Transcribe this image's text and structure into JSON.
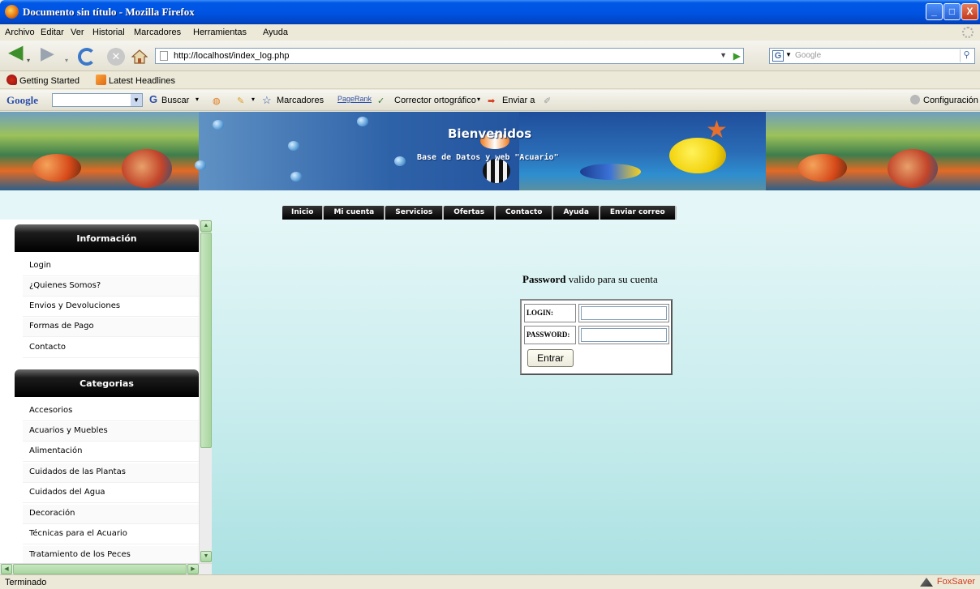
{
  "window": {
    "title": "Documento sin título - Mozilla Firefox",
    "min": "_",
    "max": "□",
    "close": "X"
  },
  "menubar": [
    "Archivo",
    "Editar",
    "Ver",
    "Historial",
    "Marcadores",
    "Herramientas",
    "Ayuda"
  ],
  "nav": {
    "url": "http://localhost/index_log.php",
    "search_placeholder": "Google",
    "search_engine_letter": "G"
  },
  "bookmarks": [
    "Getting Started",
    "Latest Headlines"
  ],
  "google_toolbar": {
    "logo": "Google",
    "buscar": "Buscar",
    "marcadores": "Marcadores",
    "pagerank": "PageRank",
    "corrector": "Corrector ortográfico",
    "enviar": "Enviar a",
    "config": "Configuración"
  },
  "banner": {
    "title": "Bienvenidos",
    "subtitle": "Base de Datos y web \"Acuario\""
  },
  "topmenu": [
    "Inicio",
    "Mi cuenta",
    "Servicios",
    "Ofertas",
    "Contacto",
    "Ayuda",
    "Enviar correo"
  ],
  "sidebar": {
    "info_header": "Información",
    "info_items": [
      "Login",
      "¿Quienes Somos?",
      "Envios y Devoluciones",
      "Formas de Pago",
      "Contacto"
    ],
    "cat_header": "Categorias",
    "cat_items": [
      "Accesorios",
      "Acuarios y Muebles",
      "Alimentación",
      "Cuidados de las Plantas",
      "Cuidados del Agua",
      "Decoración",
      "Técnicas para el Acuario",
      "Tratamiento de los Peces"
    ]
  },
  "login": {
    "message_bold": "Password",
    "message_rest": " valido para su cuenta",
    "login_label": "LOGIN:",
    "password_label": "PASSWORD:",
    "login_value": "",
    "password_value": "",
    "submit": "Entrar"
  },
  "status": {
    "text": "Terminado",
    "addon": "FoxSaver"
  }
}
